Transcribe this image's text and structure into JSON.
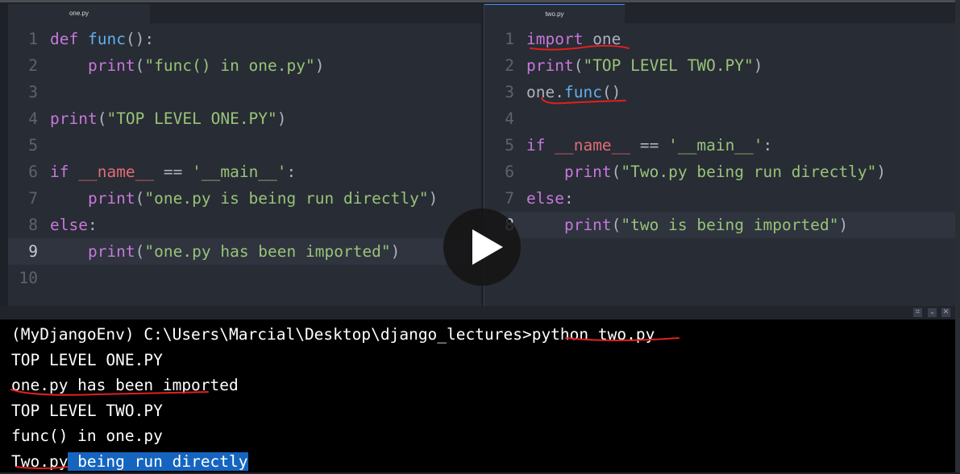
{
  "left_pane": {
    "tab": "one.py",
    "current_line": 9,
    "lines": [
      {
        "n": "1",
        "t": [
          [
            "def ",
            "kw"
          ],
          [
            "func",
            "fn"
          ],
          [
            "():",
            "pl"
          ]
        ]
      },
      {
        "n": "2",
        "t": [
          [
            "    print",
            "kw"
          ],
          [
            "(",
            "pl"
          ],
          [
            "\"func() in one.py\"",
            "st"
          ],
          [
            ")",
            "pl"
          ]
        ]
      },
      {
        "n": "3",
        "t": []
      },
      {
        "n": "4",
        "t": [
          [
            "print",
            "kw"
          ],
          [
            "(",
            "pl"
          ],
          [
            "\"TOP LEVEL ONE.PY\"",
            "st"
          ],
          [
            ")",
            "pl"
          ]
        ]
      },
      {
        "n": "5",
        "t": []
      },
      {
        "n": "6",
        "t": [
          [
            "if ",
            "kw"
          ],
          [
            "__name__",
            "nm"
          ],
          [
            " == ",
            "pl"
          ],
          [
            "'__main__'",
            "st"
          ],
          [
            ":",
            "pl"
          ]
        ]
      },
      {
        "n": "7",
        "t": [
          [
            "    print",
            "kw"
          ],
          [
            "(",
            "pl"
          ],
          [
            "\"one.py is being run directly\"",
            "st"
          ],
          [
            ")",
            "pl"
          ]
        ]
      },
      {
        "n": "8",
        "t": [
          [
            "else",
            "kw"
          ],
          [
            ":",
            "pl"
          ]
        ]
      },
      {
        "n": "9",
        "t": [
          [
            "    print",
            "kw"
          ],
          [
            "(",
            "pl"
          ],
          [
            "\"one.py has been imported\"",
            "st"
          ],
          [
            ")",
            "pl"
          ]
        ]
      },
      {
        "n": "10",
        "t": []
      }
    ]
  },
  "right_pane": {
    "tab": "two.py",
    "current_line": 8,
    "lines": [
      {
        "n": "1",
        "t": [
          [
            "import ",
            "kw"
          ],
          [
            "one",
            "pl"
          ]
        ]
      },
      {
        "n": "2",
        "t": [
          [
            "print",
            "kw"
          ],
          [
            "(",
            "pl"
          ],
          [
            "\"TOP LEVEL TWO.PY\"",
            "st"
          ],
          [
            ")",
            "pl"
          ]
        ]
      },
      {
        "n": "3",
        "t": [
          [
            "one.",
            "pl"
          ],
          [
            "func",
            "fn"
          ],
          [
            "()",
            "pl"
          ]
        ]
      },
      {
        "n": "4",
        "t": []
      },
      {
        "n": "5",
        "t": [
          [
            "if ",
            "kw"
          ],
          [
            "__name__",
            "nm"
          ],
          [
            " == ",
            "pl"
          ],
          [
            "'__main__'",
            "st"
          ],
          [
            ":",
            "pl"
          ]
        ]
      },
      {
        "n": "6",
        "t": [
          [
            "    print",
            "kw"
          ],
          [
            "(",
            "pl"
          ],
          [
            "\"Two.py being run directly\"",
            "st"
          ],
          [
            ")",
            "pl"
          ]
        ]
      },
      {
        "n": "7",
        "t": [
          [
            "else",
            "kw"
          ],
          [
            ":",
            "pl"
          ]
        ]
      },
      {
        "n": "8",
        "t": [
          [
            "    print",
            "kw"
          ],
          [
            "(",
            "pl"
          ],
          [
            "\"two is being imported\"",
            "st"
          ],
          [
            ")",
            "pl"
          ]
        ]
      }
    ]
  },
  "terminal": {
    "prompt": "(MyDjangoEnv) C:\\Users\\Marcial\\Desktop\\django_lectures>python two.py",
    "output": [
      "TOP LEVEL ONE.PY",
      "one.py has been imported",
      "TOP LEVEL TWO.PY",
      "func() in one.py"
    ],
    "last_plain": "Two.py",
    "last_selected": " being run directly",
    "buttons": {
      "maximize": "⌗",
      "collapse": "⌄",
      "close": "✕"
    }
  },
  "colors": {
    "keyword": "#c678dd",
    "function": "#61afef",
    "string": "#98c379",
    "variable": "#e06c75",
    "annotation": "#e02020",
    "selection": "#1565c0"
  },
  "overlay": {
    "icon": "play-icon"
  }
}
